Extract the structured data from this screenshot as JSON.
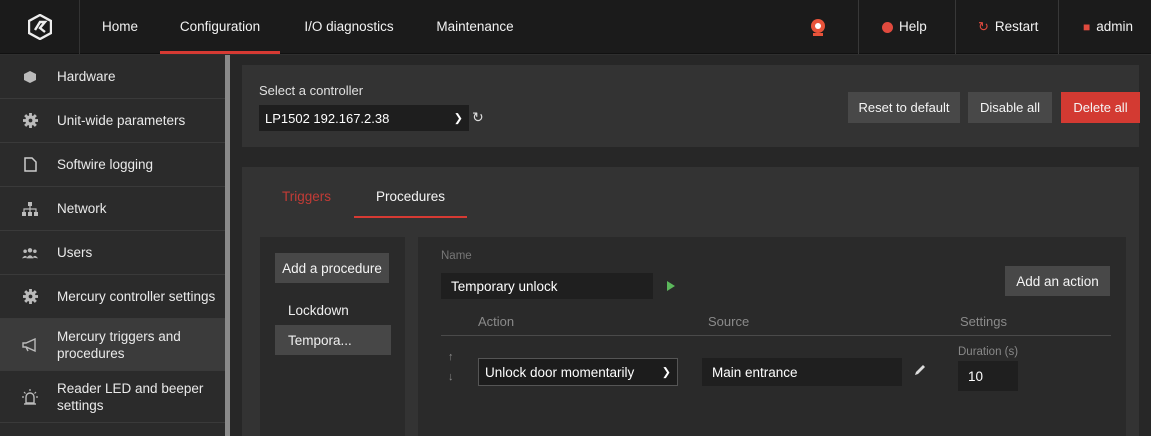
{
  "nav": {
    "items": [
      {
        "label": "Home"
      },
      {
        "label": "Configuration"
      },
      {
        "label": "I/O diagnostics"
      },
      {
        "label": "Maintenance"
      }
    ],
    "help_label": "Help",
    "restart_label": "Restart",
    "user_label": "admin"
  },
  "sidebar": {
    "items": [
      {
        "label": "Hardware",
        "icon": "cube-icon"
      },
      {
        "label": "Unit-wide parameters",
        "icon": "gear-icon"
      },
      {
        "label": "Softwire logging",
        "icon": "file-icon"
      },
      {
        "label": "Network",
        "icon": "network-icon"
      },
      {
        "label": "Users",
        "icon": "users-icon"
      },
      {
        "label": "Mercury controller settings",
        "icon": "gear-icon"
      },
      {
        "label": "Mercury triggers and procedures",
        "icon": "megaphone-icon"
      },
      {
        "label": "Reader LED and beeper settings",
        "icon": "siren-icon"
      }
    ]
  },
  "controller": {
    "select_label": "Select a controller",
    "selected": "LP1502 192.167.2.38",
    "reset_label": "Reset to default",
    "disable_label": "Disable all",
    "delete_label": "Delete all"
  },
  "tabs": {
    "triggers": "Triggers",
    "procedures": "Procedures"
  },
  "procedures": {
    "add_label": "Add a procedure",
    "items": [
      {
        "label": "Lockdown"
      },
      {
        "label": "Tempora..."
      }
    ]
  },
  "detail": {
    "name_label": "Name",
    "name_value": "Temporary unlock",
    "add_action_label": "Add an action",
    "columns": {
      "action": "Action",
      "source": "Source",
      "settings": "Settings"
    },
    "row": {
      "action": "Unlock door momentarily",
      "source": "Main entrance",
      "duration_label": "Duration (s)",
      "duration_value": "10"
    }
  },
  "colors": {
    "accent": "#d63a33",
    "play": "#5cb85c"
  }
}
